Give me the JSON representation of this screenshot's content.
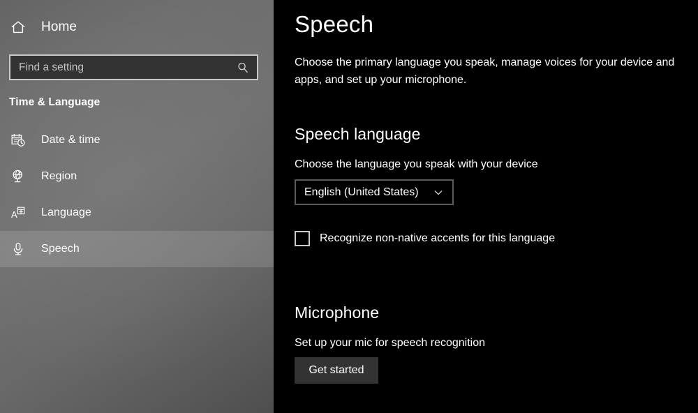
{
  "sidebar": {
    "home": {
      "label": "Home",
      "icon": "home-icon"
    },
    "search": {
      "placeholder": "Find a setting",
      "value": "",
      "icon": "search-icon"
    },
    "category_title": "Time & Language",
    "items": [
      {
        "label": "Date & time",
        "icon": "calendar-clock-icon",
        "selected": false
      },
      {
        "label": "Region",
        "icon": "globe-icon",
        "selected": false
      },
      {
        "label": "Language",
        "icon": "language-icon",
        "selected": false
      },
      {
        "label": "Speech",
        "icon": "microphone-icon",
        "selected": true
      }
    ]
  },
  "content": {
    "title": "Speech",
    "description": "Choose the primary language you speak, manage voices for your device and apps, and set up your microphone.",
    "speech_language": {
      "heading": "Speech language",
      "subtext": "Choose the language you speak with your device",
      "dropdown": {
        "value": "English (United States)",
        "icon": "chevron-down-icon",
        "options": [
          "English (United States)"
        ]
      },
      "checkbox": {
        "label": "Recognize non-native accents for this language",
        "checked": false
      }
    },
    "microphone": {
      "heading": "Microphone",
      "subtext": "Set up your mic for speech recognition",
      "button_label": "Get started"
    }
  },
  "colors": {
    "sidebar_base": "#6e6e6e",
    "content_bg": "#000000",
    "selected_row": "#848484",
    "control_fill": "#333333",
    "control_border": "#c9c9c9",
    "dropdown_border": "#5a5a5a",
    "text": "#ffffff"
  }
}
